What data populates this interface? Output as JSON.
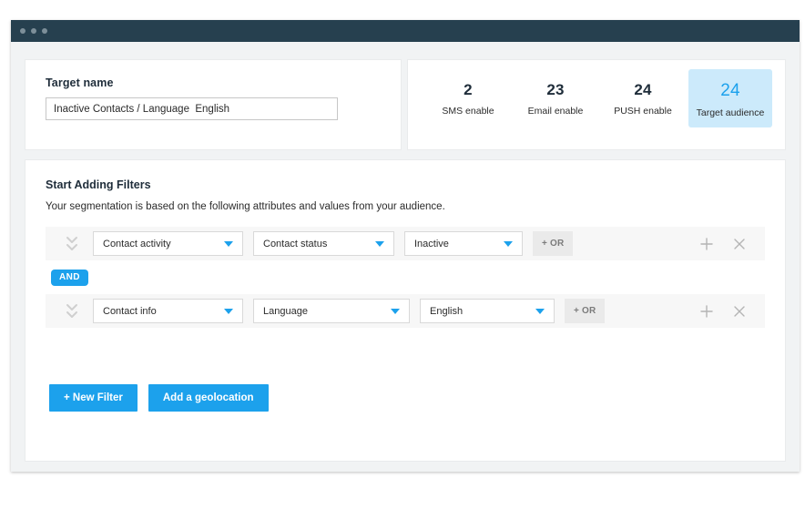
{
  "window": {
    "dots_count": 3
  },
  "target": {
    "label": "Target name",
    "value": "Inactive Contacts / Language  English",
    "placeholder": "Target name"
  },
  "stats": [
    {
      "value": "2",
      "label": "SMS enable",
      "highlight": false
    },
    {
      "value": "23",
      "label": "Email enable",
      "highlight": false
    },
    {
      "value": "24",
      "label": "PUSH enable",
      "highlight": false
    },
    {
      "value": "24",
      "label": "Target audience",
      "highlight": true
    }
  ],
  "filters": {
    "title": "Start Adding Filters",
    "subtitle": "Your segmentation is based on the following attributes and values from your audience.",
    "connector": "AND",
    "or_label": "+ OR",
    "rows": [
      {
        "attribute": "Contact activity",
        "field": "Contact status",
        "value": "Inactive"
      },
      {
        "attribute": "Contact info",
        "field": "Language",
        "value": "English"
      }
    ]
  },
  "actions": {
    "new_filter": "+ New Filter",
    "geolocation": "Add a geolocation"
  },
  "colors": {
    "accent": "#1ca1ec",
    "titlebar": "#26404f",
    "highlight_bg": "#cceafb",
    "page_bg": "#f1f3f4",
    "row_bg": "#f7f7f7"
  }
}
